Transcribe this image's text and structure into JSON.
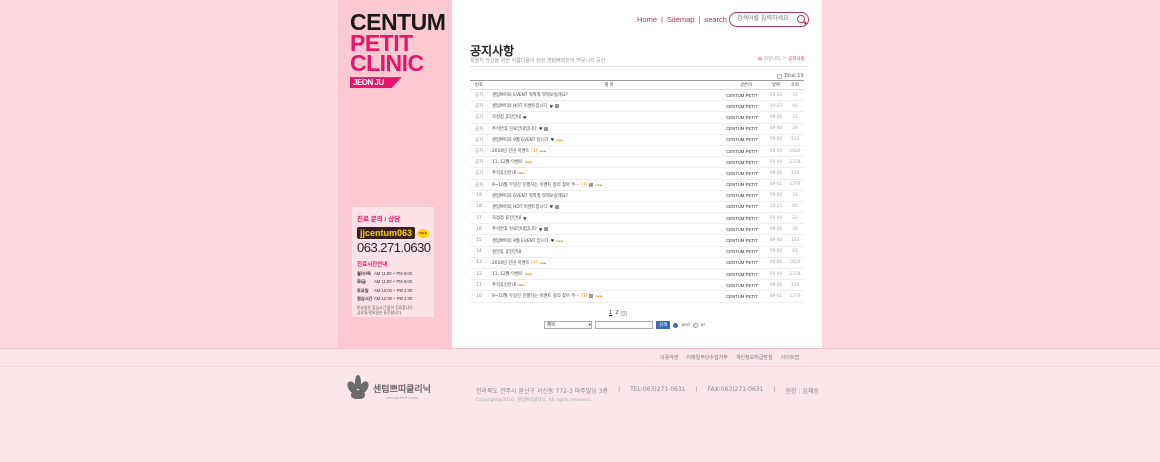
{
  "colors": {
    "accent": "#e5166c",
    "nav": "#b0375c",
    "button": "#3a6bb7",
    "sidebar": "#fbc9d2",
    "background": "#fdd8df"
  },
  "logo": {
    "line1": "CENTUM",
    "line2": "PETIT",
    "line3": "CLINIC",
    "tag": "JEON JU"
  },
  "topnav": {
    "home": "Home",
    "sitemap": "Sitemap",
    "search": "search",
    "sep": "|"
  },
  "search": {
    "placeholder": "검색어를 입력하세요"
  },
  "page": {
    "title": "공지사항",
    "subtitle": "특별히 당신을 위한 아름다움의 완성 센텀뻐띠만의 커뮤니티 공간"
  },
  "breadcrumb": {
    "home": "커뮤니티",
    "sep": ">",
    "current": "공지사항"
  },
  "total": "Total 19",
  "board": {
    "headers": {
      "no": "번호",
      "subject": "제 목",
      "writer": "글쓴이",
      "date": "날짜",
      "hits": "조회"
    },
    "rows": [
      {
        "no": "공지",
        "subject": "센텀쁘띠의 EVENT 뭐뭐뭐 뭐뭐보실래요?",
        "writer": "CENTUM PETIT",
        "date": "09-00",
        "hits": "31",
        "heart": false,
        "img": false,
        "new": false,
        "cmt": ""
      },
      {
        "no": "공지",
        "subject": "센텀쁘띠의 HOT 이벤트입니다",
        "writer": "CENTUM PETIT",
        "date": "10-23",
        "hits": "60",
        "heart": true,
        "img": true,
        "new": false,
        "cmt": ""
      },
      {
        "no": "공지",
        "subject": "자정점 휴진안내",
        "writer": "CENTUM PETIT",
        "date": "09-00",
        "hits": "33",
        "heart": true,
        "img": false,
        "new": false,
        "cmt": ""
      },
      {
        "no": "공지",
        "subject": "추석연휴 진료안내입니다",
        "writer": "CENTUM PETIT",
        "date": "09-00",
        "hits": "39",
        "heart": true,
        "img": true,
        "new": false,
        "cmt": ""
      },
      {
        "no": "공지",
        "subject": "센텀쁘띠의 9월 EVENT 입니다",
        "writer": "CENTUM PETIT",
        "date": "09-00",
        "hits": "132",
        "heart": true,
        "img": false,
        "new": true,
        "cmt": ""
      },
      {
        "no": "공지",
        "subject": "2016년 신년 이벤트",
        "writer": "CENTUM PETIT",
        "date": "09-00",
        "hits": "1620",
        "heart": false,
        "img": false,
        "new": true,
        "cmt": "[1]"
      },
      {
        "no": "공지",
        "subject": "11, 12월 이벤트",
        "writer": "CENTUM PETIT",
        "date": "09-00",
        "hits": "1228",
        "heart": false,
        "img": false,
        "new": true,
        "cmt": ""
      },
      {
        "no": "공지",
        "subject": "추석휴진안내",
        "writer": "CENTUM PETIT",
        "date": "09-00",
        "hits": "328",
        "heart": false,
        "img": false,
        "new": true,
        "cmt": ""
      },
      {
        "no": "공지",
        "subject": "9~10월 두달간 진행하는 이벤트 정리 찾아 주···",
        "writer": "CENTUM PETIT",
        "date": "09-01",
        "hits": "1378",
        "heart": false,
        "img": true,
        "new": true,
        "cmt": "[1]"
      },
      {
        "no": "19",
        "subject": "센텀쁘띠의 EVENT 뭐뭐뭐 뭐뭐보실래요?",
        "writer": "CENTUM PETIT",
        "date": "09-00",
        "hits": "33",
        "heart": false,
        "img": false,
        "new": false,
        "cmt": ""
      },
      {
        "no": "18",
        "subject": "센텀쁘띠의 HOT 이벤트입니다",
        "writer": "CENTUM PETIT",
        "date": "10-23",
        "hits": "60",
        "heart": true,
        "img": true,
        "new": false,
        "cmt": ""
      },
      {
        "no": "17",
        "subject": "자정점 휴진안내",
        "writer": "CENTUM PETIT",
        "date": "09-00",
        "hits": "33",
        "heart": true,
        "img": false,
        "new": false,
        "cmt": ""
      },
      {
        "no": "16",
        "subject": "추석연휴 진료안내입니다",
        "writer": "CENTUM PETIT",
        "date": "09-00",
        "hits": "39",
        "heart": true,
        "img": true,
        "new": false,
        "cmt": ""
      },
      {
        "no": "15",
        "subject": "센텀쁘띠의 9월 EVENT 입니다",
        "writer": "CENTUM PETIT",
        "date": "09-00",
        "hits": "132",
        "heart": true,
        "img": false,
        "new": true,
        "cmt": ""
      },
      {
        "no": "14",
        "subject": "설연휴 휴진안내",
        "writer": "CENTUM PETIT",
        "date": "09-00",
        "hits": "63",
        "heart": false,
        "img": false,
        "new": false,
        "cmt": ""
      },
      {
        "no": "13",
        "subject": "2016년 신년 이벤트",
        "writer": "CENTUM PETIT",
        "date": "09-00",
        "hits": "1620",
        "heart": false,
        "img": false,
        "new": true,
        "cmt": "[1]"
      },
      {
        "no": "12",
        "subject": "11, 12월 이벤트",
        "writer": "CENTUM PETIT",
        "date": "09-00",
        "hits": "1228",
        "heart": false,
        "img": false,
        "new": true,
        "cmt": ""
      },
      {
        "no": "11",
        "subject": "추석휴진안내",
        "writer": "CENTUM PETIT",
        "date": "09-00",
        "hits": "328",
        "heart": false,
        "img": false,
        "new": true,
        "cmt": ""
      },
      {
        "no": "10",
        "subject": "9~10월 두달간 진행하는 이벤트 정리 찾아 주···",
        "writer": "CENTUM PETIT",
        "date": "09-01",
        "hits": "1378",
        "heart": false,
        "img": true,
        "new": true,
        "cmt": "[1]"
      }
    ]
  },
  "paging": {
    "p1": "1",
    "p2": "2",
    "next": "»"
  },
  "board_search": {
    "field": "제목",
    "button": "검색",
    "opt_and": "and",
    "opt_or": "or"
  },
  "contact": {
    "title": "진료 문의 / 상담",
    "kakao_id": "jjcentum063",
    "talk": "TALK",
    "phone": "063.271.0630",
    "hours_title": "진료시간안내",
    "hours": [
      {
        "day": "월/수/목",
        "time": "AM 11:00 ~ PM 8:00"
      },
      {
        "day": "화/금",
        "time": "AM 11:00 ~ PM 9:00"
      },
      {
        "day": "토요일",
        "time": "AM 10:00 ~ PM 2:00"
      },
      {
        "day": "점심시간",
        "time": "AM 12:30 ~ PM 2:00"
      }
    ],
    "note1": "토요일은 점심시간 없이 진료합니다.",
    "note2": "공휴일/일요일은 휴진합니다."
  },
  "footer": {
    "links": [
      "이용약관",
      "이메일무단수집거부",
      "개인정보취급방침",
      "사이트맵"
    ],
    "brand": "센텀쁘띠클리닉",
    "brand_en": "CENTUM PETIT CLINIC",
    "address": "전라북도 전주시 완산구 서신동 772-3 마주빌딩 3층",
    "tel": "TEL:063)271-0631",
    "fax": "FAX:063)271-0631",
    "ceo": "원장 : 심재승",
    "sep": "|",
    "copyright": "Copyright@2016. 센텀쁘띠클리닉. All rights reserved."
  }
}
